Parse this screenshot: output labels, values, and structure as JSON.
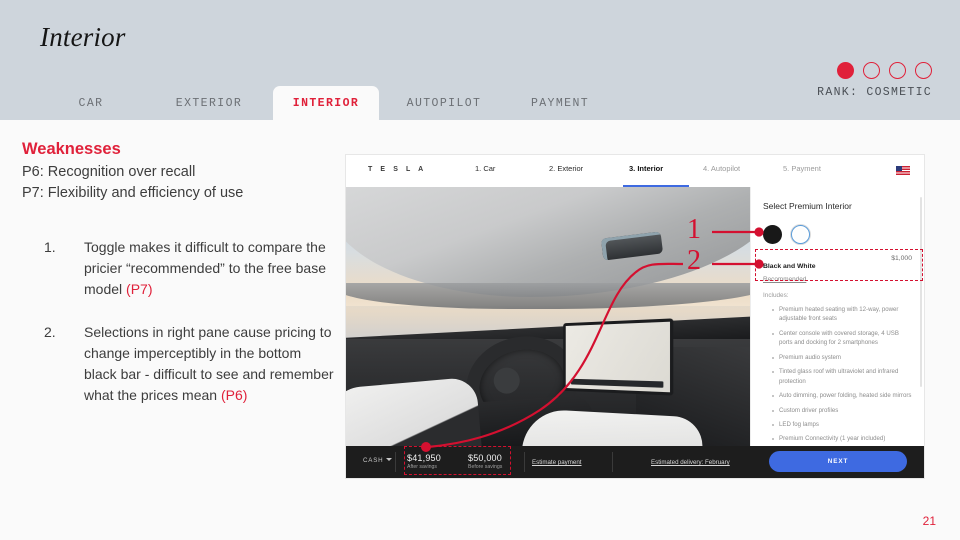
{
  "slide": {
    "title": "Interior",
    "page_number": "21"
  },
  "nav": {
    "tabs": [
      {
        "label": "CAR",
        "active": false
      },
      {
        "label": "EXTERIOR",
        "active": false
      },
      {
        "label": "INTERIOR",
        "active": true
      },
      {
        "label": "AUTOPILOT",
        "active": false
      },
      {
        "label": "PAYMENT",
        "active": false
      }
    ]
  },
  "rank": {
    "label": "RANK: COSMETIC",
    "dots_total": 4,
    "dots_filled": 1,
    "accent_color": "#e0213a"
  },
  "left": {
    "weaknesses_title": "Weaknesses",
    "heuristics": [
      "P6: Recognition over recall",
      "P7: Flexibility and efficiency of use"
    ],
    "points": [
      {
        "text": "Toggle makes it difficult to compare the pricier “recommended” to the free base model ",
        "ref": "(P7)"
      },
      {
        "text": "Selections in right pane cause pricing to change imperceptibly in the bottom black bar - difficult to see and remember what the prices mean ",
        "ref": "(P6)"
      }
    ]
  },
  "tesla": {
    "logo": "T E S L A",
    "steps": [
      {
        "label": "1. Car",
        "state": "done"
      },
      {
        "label": "2. Exterior",
        "state": "done"
      },
      {
        "label": "3. Interior",
        "state": "current"
      },
      {
        "label": "4. Autopilot",
        "state": "upcoming"
      },
      {
        "label": "5. Payment",
        "state": "upcoming"
      }
    ],
    "flag_icon": "us-flag-icon",
    "pane": {
      "title": "Select Premium Interior",
      "swatches": [
        {
          "name": "black-swatch",
          "color": "#181818",
          "selected": false
        },
        {
          "name": "white-swatch",
          "color": "#ffffff",
          "selected": true
        }
      ],
      "option_name": "Black and White",
      "option_price": "$1,000",
      "option_recommended": "Recommended",
      "includes_label": "Includes:",
      "features": [
        "Premium heated seating with 12-way, power adjustable front seats",
        "Center console with covered storage, 4 USB ports and docking for 2 smartphones",
        "Premium audio system",
        "Tinted glass roof with ultraviolet and infrared protection",
        "Auto dimming, power folding, heated side mirrors",
        "Custom driver profiles",
        "LED fog lamps",
        "Premium Connectivity (1 year included)"
      ]
    },
    "bar": {
      "payment_mode": "CASH",
      "prices": [
        {
          "value": "$41,950",
          "sub": "After savings"
        },
        {
          "value": "$50,000",
          "sub": "Before savings"
        }
      ],
      "estimate_payment": "Estimate payment",
      "estimated_delivery": "Estimated delivery: February",
      "next_label": "NEXT",
      "next_color": "#3e6ae1"
    }
  },
  "annotations": {
    "marker_1": "1",
    "marker_2": "2",
    "marker_color": "#d41030"
  }
}
